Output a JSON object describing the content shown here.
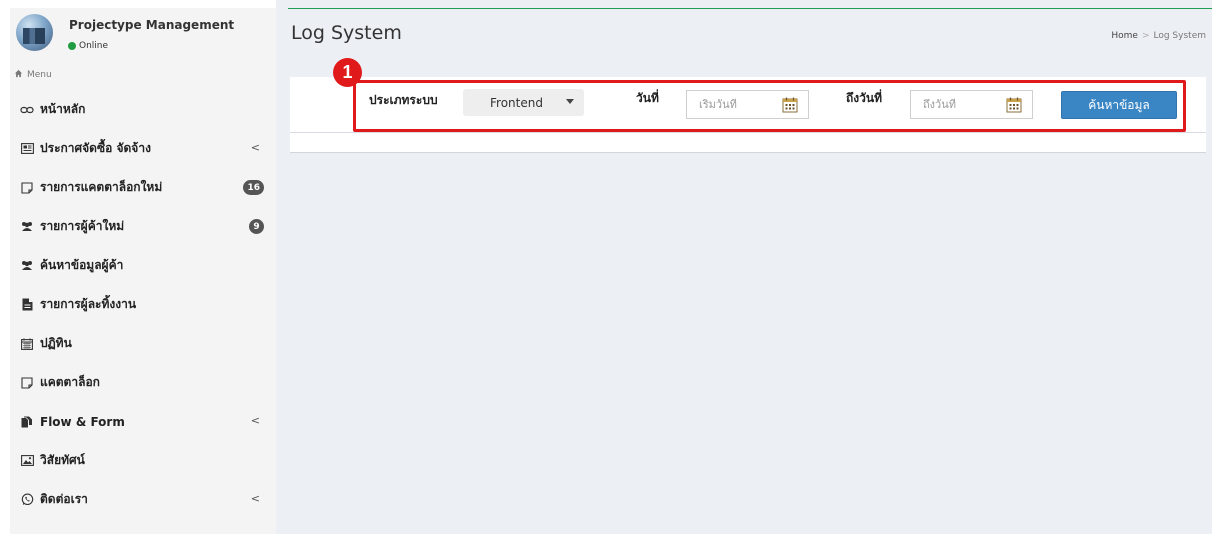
{
  "sidebar": {
    "app_name": "Projectype Management",
    "status": "Online",
    "menu_header": "Menu",
    "items": [
      {
        "label": "หน้าหลัก",
        "icon": "link-icon"
      },
      {
        "label": "ประกาศจัดซื้อ จัดจ้าง",
        "icon": "newspaper-icon",
        "caret": "<"
      },
      {
        "label": "รายการแคตตาล็อกใหม่",
        "icon": "note-icon",
        "badge": "16"
      },
      {
        "label": "รายการผู้ค้าใหม่",
        "icon": "users-icon",
        "badge": "9"
      },
      {
        "label": "ค้นหาข้อมูลผู้ค้า",
        "icon": "users-icon"
      },
      {
        "label": "รายการผู้ละทิ้งงาน",
        "icon": "file-icon"
      },
      {
        "label": "ปฏิทิน",
        "icon": "calendar-icon"
      },
      {
        "label": "แคตตาล็อก",
        "icon": "note-icon"
      },
      {
        "label": "Flow & Form",
        "icon": "files-icon",
        "caret": "<"
      },
      {
        "label": "วิสัยทัศน์",
        "icon": "image-icon"
      },
      {
        "label": "ติดต่อเรา",
        "icon": "whatsapp-icon",
        "caret": "<"
      }
    ]
  },
  "header": {
    "title": "Log System",
    "breadcrumb": {
      "home": "Home",
      "separator": ">",
      "current": "Log System"
    }
  },
  "filters": {
    "system_type_label": "ประเภทระบบ",
    "system_type_value": "Frontend",
    "date_label": "วันที่",
    "start_date_placeholder": "เริ่มวันที่",
    "to_date_label": "ถึงวันที่",
    "end_date_placeholder": "ถึงวันที่",
    "search_button": "ค้นหาข้อมูล"
  },
  "annotation": {
    "number": "1",
    "color": "#e01a1a"
  },
  "colors": {
    "primary_button": "#3a86c4",
    "online": "#1f9d45",
    "accent_line": "#1e9e52",
    "content_bg": "#ecf0f5",
    "sidebar_bg": "#f4f4f5"
  }
}
